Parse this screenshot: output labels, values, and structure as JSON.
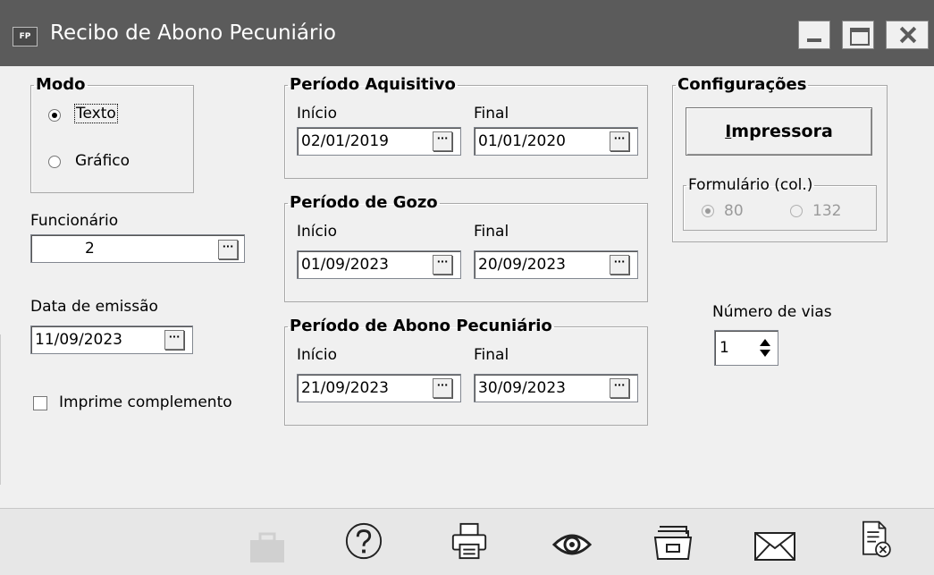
{
  "window": {
    "app_icon": "FP",
    "title": "Recibo de Abono Pecuniário"
  },
  "modo": {
    "legend": "Modo",
    "options": [
      "Texto",
      "Gráfico"
    ],
    "selected": "Texto"
  },
  "funcionario": {
    "label": "Funcionário",
    "value": "2"
  },
  "data_emissao": {
    "label": "Data de emissão",
    "value": "11/09/2023"
  },
  "imprime_complemento": {
    "label": "Imprime complemento",
    "checked": false
  },
  "periodo_aquisitivo": {
    "legend": "Período Aquisitivo",
    "inicio_label": "Início",
    "final_label": "Final",
    "inicio": "02/01/2019",
    "final": "01/01/2020"
  },
  "periodo_gozo": {
    "legend": "Período de Gozo",
    "inicio_label": "Início",
    "final_label": "Final",
    "inicio": "01/09/2023",
    "final": "20/09/2023"
  },
  "periodo_abono": {
    "legend": "Período de Abono Pecuniário",
    "inicio_label": "Início",
    "final_label": "Final",
    "inicio": "21/09/2023",
    "final": "30/09/2023"
  },
  "configuracoes": {
    "legend": "Configurações",
    "impressora_button_rest": "mpressora",
    "impressora_button_hotkey": "I",
    "formulario_legend": "Formulário (col.)",
    "formulario_options": [
      "80",
      "132"
    ],
    "formulario_selected": "80"
  },
  "numero_vias": {
    "label": "Número de vias",
    "value": "1"
  },
  "dots_label": "···",
  "toolbar": [
    "briefcase-icon",
    "help-icon",
    "printer-icon",
    "preview-eye-icon",
    "folder-icon",
    "mail-icon",
    "close-document-icon"
  ]
}
